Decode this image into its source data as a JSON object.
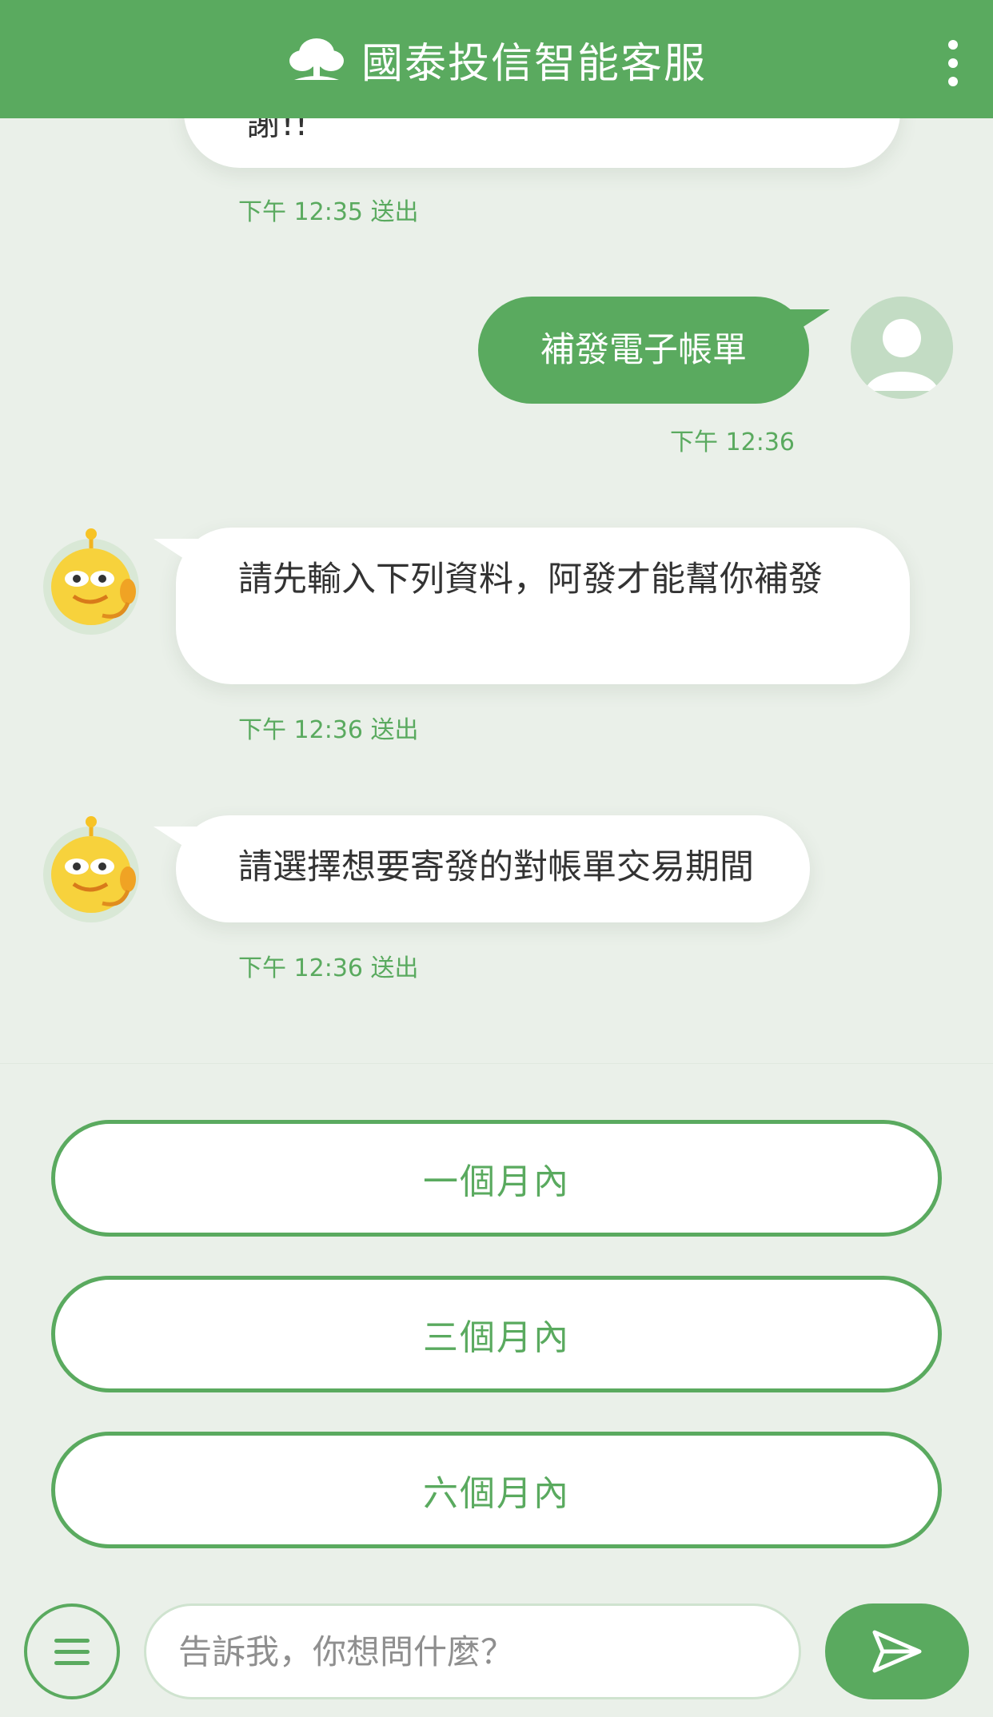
{
  "header": {
    "title": "國泰投信智能客服",
    "logo_icon": "tree-icon",
    "more_icon": "more-vertical-icon"
  },
  "messages": [
    {
      "from": "bot",
      "text": "謝!!",
      "time": "下午 12:35 送出"
    },
    {
      "from": "user",
      "text": "補發電子帳單",
      "time": "下午 12:36"
    },
    {
      "from": "bot",
      "text": "請先輸入下列資料，阿發才能幫你補發",
      "time": "下午 12:36 送出"
    },
    {
      "from": "bot",
      "text": "請選擇想要寄發的對帳單交易期間",
      "time": "下午 12:36 送出"
    }
  ],
  "options": [
    "一個月內",
    "三個月內",
    "六個月內"
  ],
  "input": {
    "placeholder": "告訴我，你想問什麼？",
    "menu_icon": "hamburger-menu-icon",
    "send_icon": "send-icon"
  },
  "colors": {
    "brand_green": "#5aaa5f",
    "background": "#eaf0e9",
    "bubble_bot": "#ffffff",
    "text_dark": "#333333"
  }
}
